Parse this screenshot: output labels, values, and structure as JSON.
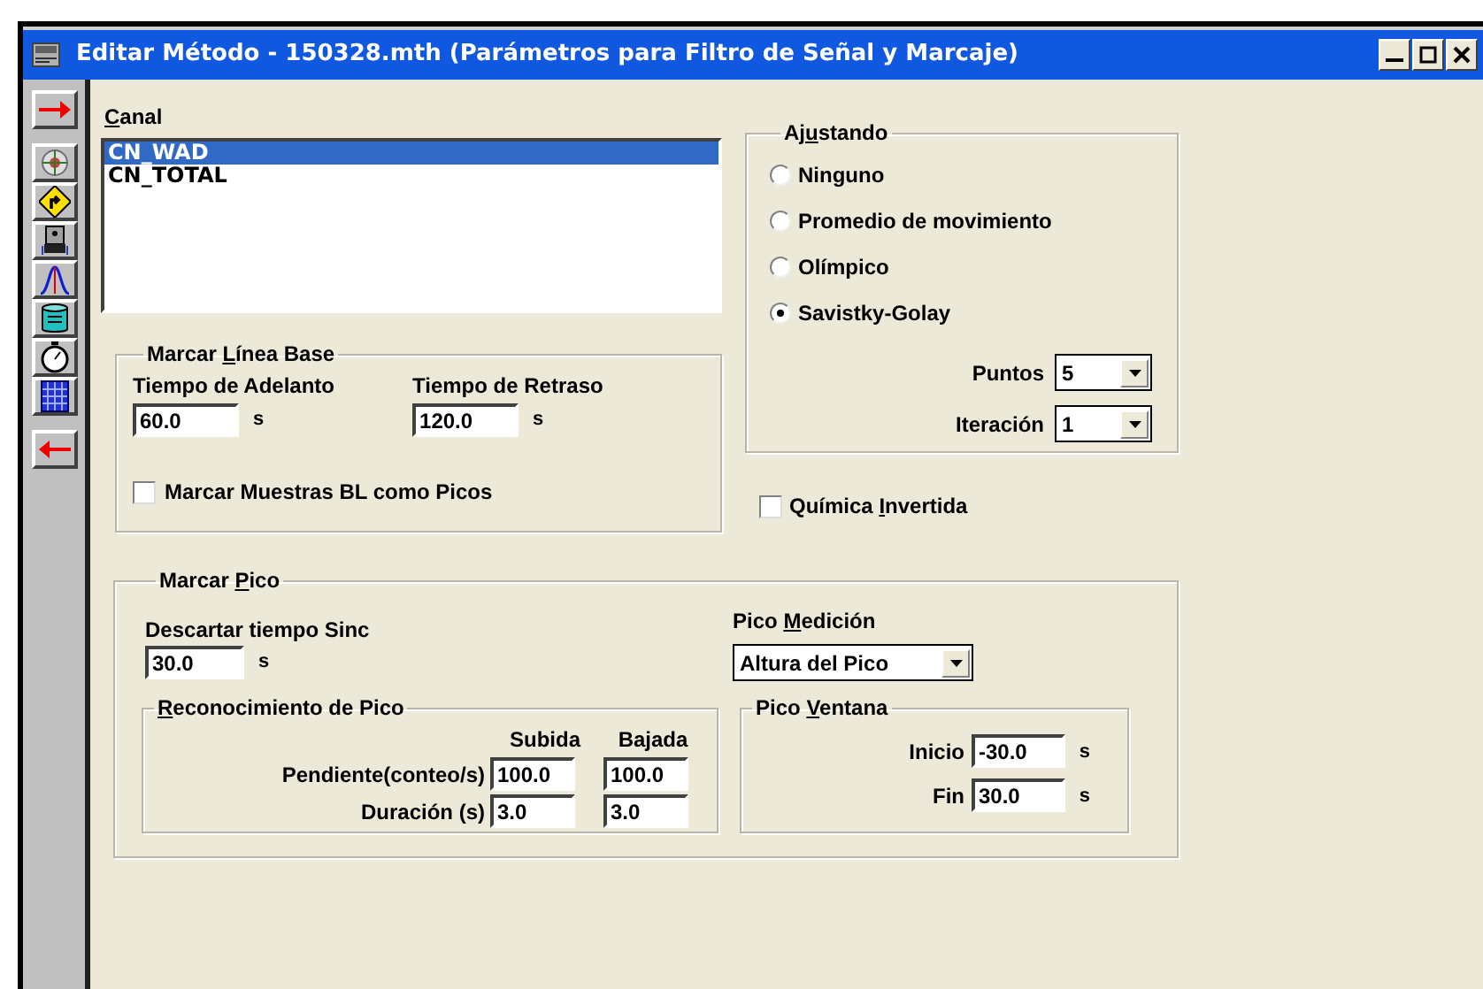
{
  "window": {
    "title": "Editar Método - 150328.mth (Parámetros para Filtro de Señal y Marcaje)"
  },
  "channel": {
    "label": {
      "key": "C",
      "rest": "anal"
    },
    "items": [
      {
        "text": "CN_WAD",
        "selected": true
      },
      {
        "text": "CN_TOTAL",
        "selected": false
      }
    ]
  },
  "baseline": {
    "title": {
      "text": "Marcar ",
      "key": "L",
      "rest": "ínea Base"
    },
    "fields": [
      {
        "label": "Tiempo de Adelanto",
        "value": "60.0",
        "unit": "s"
      },
      {
        "label": "Tiempo de Retraso",
        "value": "120.0",
        "unit": "s"
      }
    ],
    "mark_bl": {
      "label": "Marcar Muestras BL como Picos",
      "checked": false
    }
  },
  "smoothing": {
    "title": {
      "text": "Aj",
      "key": "u",
      "rest": "stando"
    },
    "options": [
      {
        "label": "Ninguno",
        "selected": false
      },
      {
        "label": "Promedio de movimiento",
        "selected": false
      },
      {
        "label": "Olímpico",
        "selected": false
      },
      {
        "label": "Savistky-Golay",
        "selected": true
      }
    ],
    "selects": [
      {
        "label": "Puntos",
        "value": "5"
      },
      {
        "label": "Iteración",
        "value": "1"
      }
    ]
  },
  "inverted": {
    "label": {
      "text": "Química ",
      "key": "I",
      "rest": "nvertida"
    },
    "checked": false
  },
  "peak": {
    "title": {
      "text": "Marcar ",
      "key": "P",
      "rest": "ico"
    },
    "discard": {
      "label": "Descartar tiempo Sinc",
      "value": "30.0",
      "unit": "s"
    },
    "measurement": {
      "label": {
        "text": "Pico ",
        "key": "M",
        "rest": "edición"
      },
      "value": "Altura del Pico"
    },
    "recognition": {
      "title": {
        "key": "R",
        "rest": "econocimiento de Pico"
      },
      "columns": [
        "Subida",
        "Bajada"
      ],
      "rows": [
        {
          "label": "Pendiente(conteo/s)",
          "values": [
            "100.0",
            "100.0"
          ]
        },
        {
          "label": "Duración (s)",
          "values": [
            "3.0",
            "3.0"
          ]
        }
      ]
    },
    "peak_window": {
      "title": {
        "text": "Pico ",
        "key": "V",
        "rest": "entana"
      },
      "fields": [
        {
          "label": "Inicio",
          "value": "-30.0",
          "unit": "s"
        },
        {
          "label": "Fin",
          "value": "30.0",
          "unit": "s"
        }
      ]
    }
  }
}
